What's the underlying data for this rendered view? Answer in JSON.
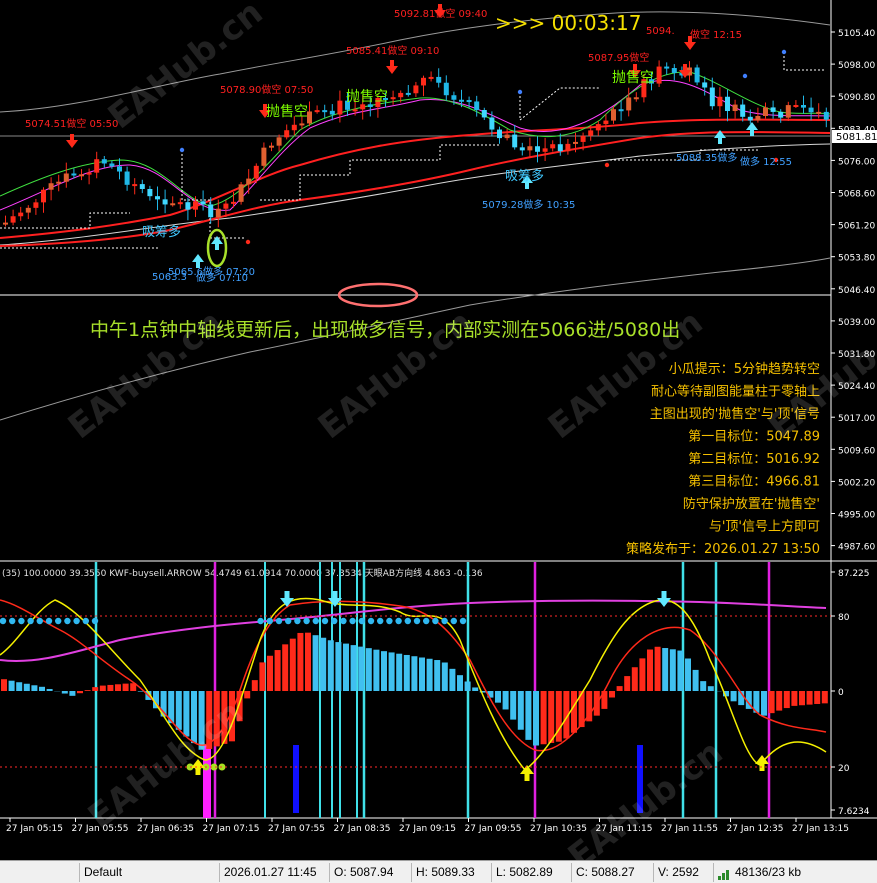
{
  "timer": ">>> 00:03:17",
  "headline": "中午1点钟中轴线更新后，出现做多信号，内部实测在5066进/5080出",
  "notes": [
    "小瓜提示：5分钟趋势转空",
    "耐心等待副图能量柱于零轴上",
    "主图出现的'抛售空'与'顶'信号",
    "第一目标位：5047.89",
    "第二目标位：5016.92",
    "第三目标位：4966.81",
    "防守保护放置在'抛售空'",
    "与'顶'信号上方即可",
    "策略发布于：2026.01.27 13:50"
  ],
  "price_axis": [
    "5105.40",
    "5098.00",
    "5090.80",
    "5083.40",
    "5076.00",
    "5068.60",
    "5061.20",
    "5053.80",
    "5046.40",
    "5039.00",
    "5031.80",
    "5024.40",
    "5017.00",
    "5009.60",
    "5002.20",
    "4995.00",
    "4987.60"
  ],
  "current_price": "5081.81",
  "sub_axis": [
    "87.225",
    "80",
    "0",
    "20",
    "7.6234"
  ],
  "sub_header": "(35) 100.0000 39.3550 KWF-buysell.ARROW 54.4749 61.0914 70.0000 37.3534 天眼AB方向线 4.863 -0.136",
  "time_axis": [
    "27 Jan 05:15",
    "27 Jan 05:55",
    "27 Jan 06:35",
    "27 Jan 07:15",
    "27 Jan 07:55",
    "27 Jan 08:35",
    "27 Jan 09:15",
    "27 Jan 09:55",
    "27 Jan 10:35",
    "27 Jan 11:15",
    "27 Jan 11:55",
    "27 Jan 12:35",
    "27 Jan 13:15"
  ],
  "main_labels": [
    {
      "text": "5074.51做空 05:50",
      "color": "#ff2020"
    },
    {
      "text": "5078.90做空 07:50",
      "color": "#ff2020"
    },
    {
      "text": "5085.41做空 09:10",
      "color": "#ff2020"
    },
    {
      "text": "5092.81做空 09:40",
      "color": "#ff2020"
    },
    {
      "text": "5087.95做空",
      "color": "#ff2020"
    },
    {
      "text": "5094.",
      "color": "#ff2020"
    },
    {
      "text": "做空 12:15",
      "color": "#ff2020"
    },
    {
      "text": "抛售空",
      "color": "#7cfc00"
    },
    {
      "text": "抛售空",
      "color": "#7cfc00"
    },
    {
      "text": "抛售空",
      "color": "#7cfc00"
    },
    {
      "text": "吸筹多",
      "color": "#40c8ff"
    },
    {
      "text": "吸筹多",
      "color": "#40c8ff"
    },
    {
      "text": "5079.28做多 10:35",
      "color": "#40a0ff"
    },
    {
      "text": "5088.35做多",
      "color": "#40a0ff"
    },
    {
      "text": "做多 12:55",
      "color": "#40a0ff"
    },
    {
      "text": "5063.3",
      "color": "#40a0ff"
    },
    {
      "text": "5065.6做多 07:20",
      "color": "#40a0ff"
    },
    {
      "text": "做多 07:10",
      "color": "#40a0ff"
    }
  ],
  "watermarks": [
    "EAHub.cn",
    "EAHub.cn",
    "EAHub.cn",
    "EAHub.cn",
    "EAHub.cn",
    "EAHub.cn",
    "EAHub.cn"
  ],
  "statusbar": {
    "profile": "Default",
    "datetime": "2026.01.27 11:45",
    "open": "O: 5087.94",
    "high": "H: 5089.33",
    "low": "L: 5082.89",
    "close": "C: 5088.27",
    "volume": "V: 2592",
    "traffic": "48136/23 kb"
  },
  "colors": {
    "up": "#ff2a1a",
    "down": "#20b8e8",
    "accent": "#f5e000",
    "grid": "#ff2a2a"
  }
}
